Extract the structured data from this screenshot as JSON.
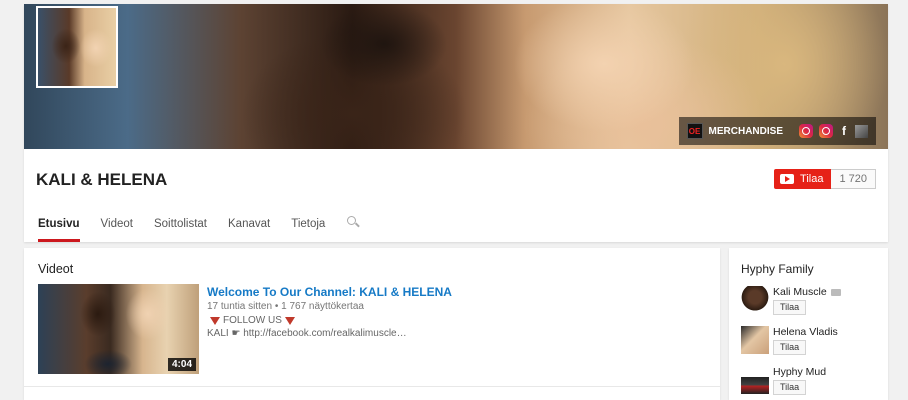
{
  "channel": {
    "name": "KALI & HELENA",
    "subscribe_label": "Tilaa",
    "subscriber_count": "1 720",
    "banner_links": {
      "merch_icon_text": "OE",
      "merch_label": "MERCHANDISE"
    },
    "icons": [
      "merchandise-icon",
      "instagram-icon",
      "instagram-icon",
      "facebook-icon",
      "box-icon"
    ]
  },
  "tabs": [
    {
      "label": "Etusivu",
      "active": true
    },
    {
      "label": "Videot"
    },
    {
      "label": "Soittolistat"
    },
    {
      "label": "Kanavat"
    },
    {
      "label": "Tietoja"
    }
  ],
  "section": {
    "title": "Videot",
    "video": {
      "title": "Welcome To Our Channel: KALI & HELENA",
      "age": "17 tuntia sitten",
      "separator": "•",
      "views": "1 767 näyttökertaa",
      "desc_line1": "FOLLOW US",
      "desc_line2": "KALI ☛ http://facebook.com/realkalimuscle…",
      "duration": "4:04"
    }
  },
  "sidebar": {
    "title": "Hyphy Family",
    "items": [
      {
        "name": "Kali Muscle",
        "button": "Tilaa"
      },
      {
        "name": "Helena Vladis",
        "button": "Tilaa"
      },
      {
        "name": "Hyphy Mud",
        "button": "Tilaa"
      }
    ]
  },
  "colors": {
    "accent_red": "#e62117",
    "link_blue": "#167ac6",
    "tab_underline": "#cc181e"
  }
}
